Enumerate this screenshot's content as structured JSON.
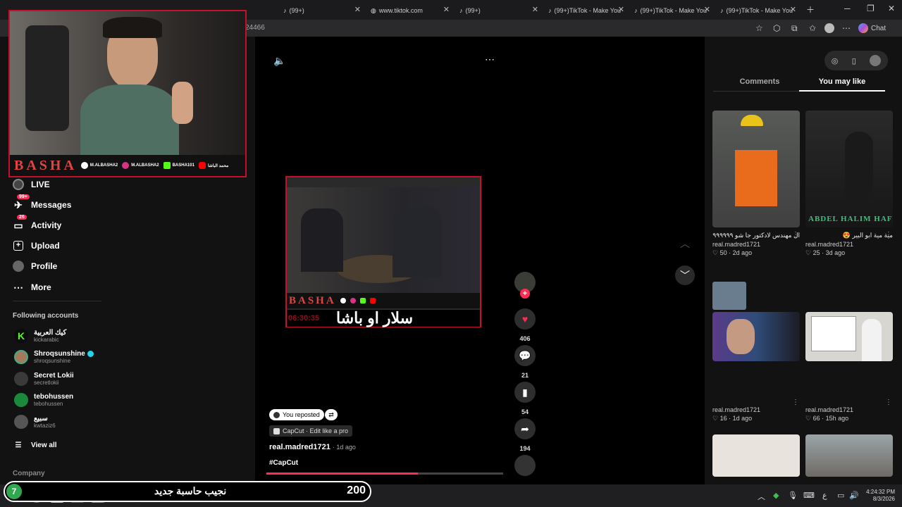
{
  "browser": {
    "tabs": [
      {
        "label": "(99+)"
      },
      {
        "label": "www.tiktok.com"
      },
      {
        "label": "(99+)"
      },
      {
        "label": "(99+)TikTok - Make You"
      },
      {
        "label": "(99+)TikTok - Make You"
      },
      {
        "label": "(99+)TikTok - Make You"
      }
    ],
    "url_fragment": "24466",
    "chat_label": "Chat"
  },
  "sidebar": {
    "nav": [
      {
        "label": "LIVE"
      },
      {
        "label": "Messages",
        "badge": "99+"
      },
      {
        "label": "Activity",
        "badge": "26"
      },
      {
        "label": "Upload"
      },
      {
        "label": "Profile"
      },
      {
        "label": "More"
      }
    ],
    "following_title": "Following accounts",
    "accounts": [
      {
        "name": "كيك العربية",
        "handle": "kickarabic"
      },
      {
        "name": "Shroqsunshine",
        "handle": "shroqsunshine"
      },
      {
        "name": "Secret Lokii",
        "handle": "secretlokii"
      },
      {
        "name": "tebohussen",
        "handle": "tebohussen"
      },
      {
        "name": "سبيع",
        "handle": "kwtaziz6"
      }
    ],
    "view_all": "View all",
    "company": "Company"
  },
  "webcam": {
    "logo": "BASHA",
    "socials": [
      "M.ALBASHA2",
      "M.ALBASHA2",
      "BASHA101",
      "محمد الباشا"
    ]
  },
  "video": {
    "banner_logo": "BASHA",
    "timer": "06:30:35",
    "arabic_caption": "سلار او باشا",
    "reposted": "You reposted",
    "capcut": "CapCut · Edit like a pro",
    "author": "real.madred1721",
    "age": "· 1d ago",
    "hashtag": "#CapCut",
    "likes": "406",
    "comments": "21",
    "saves": "54",
    "shares": "194"
  },
  "right_panel": {
    "tabs": [
      "Comments",
      "You may like"
    ],
    "cards": [
      {
        "title": "ال مهندس لادكتور جا شو ٩٩٩٩٩٩٩٩٩",
        "user": "real.madred1721",
        "likes": "50",
        "age": "2d ago"
      },
      {
        "title": "مية مية ابو البير 😍",
        "user": "real.madred1721",
        "likes": "25",
        "age": "3d ago"
      },
      {
        "title": "",
        "user": "real.madred1721",
        "likes": "16",
        "age": "1d ago"
      },
      {
        "title": "",
        "user": "real.madred1721",
        "likes": "66",
        "age": "15h ago"
      }
    ],
    "thumb_text": "ABDEL HALIM HAFEZ"
  },
  "stream_overlay": {
    "level": "7",
    "text": "نجيب حاسبة جديد",
    "count": "200"
  },
  "clock": {
    "time": "4:24:32 PM",
    "date": "8/3/2026"
  },
  "colors": {
    "accent": "#fe2c55",
    "basha_red": "#c4102a"
  }
}
